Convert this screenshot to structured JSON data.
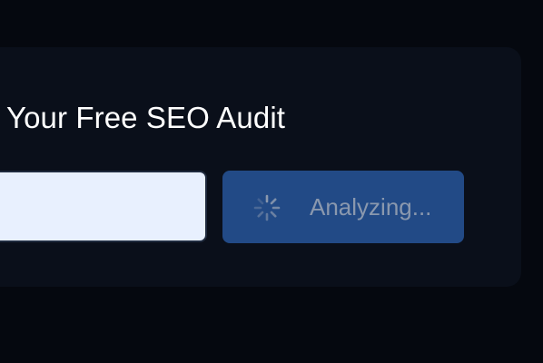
{
  "audit_card": {
    "title": "Your Free SEO Audit",
    "url_input": {
      "value": "",
      "placeholder": ""
    },
    "submit_button": {
      "label": "Analyzing...",
      "state": "loading",
      "icon": "spinner-icon"
    }
  },
  "colors": {
    "page_background": "#05080f",
    "card_background": "#0a0f1a",
    "input_background": "#e8f0fe",
    "button_background": "#224a86",
    "button_text": "#8a98ae",
    "title_text": "#ffffff"
  }
}
